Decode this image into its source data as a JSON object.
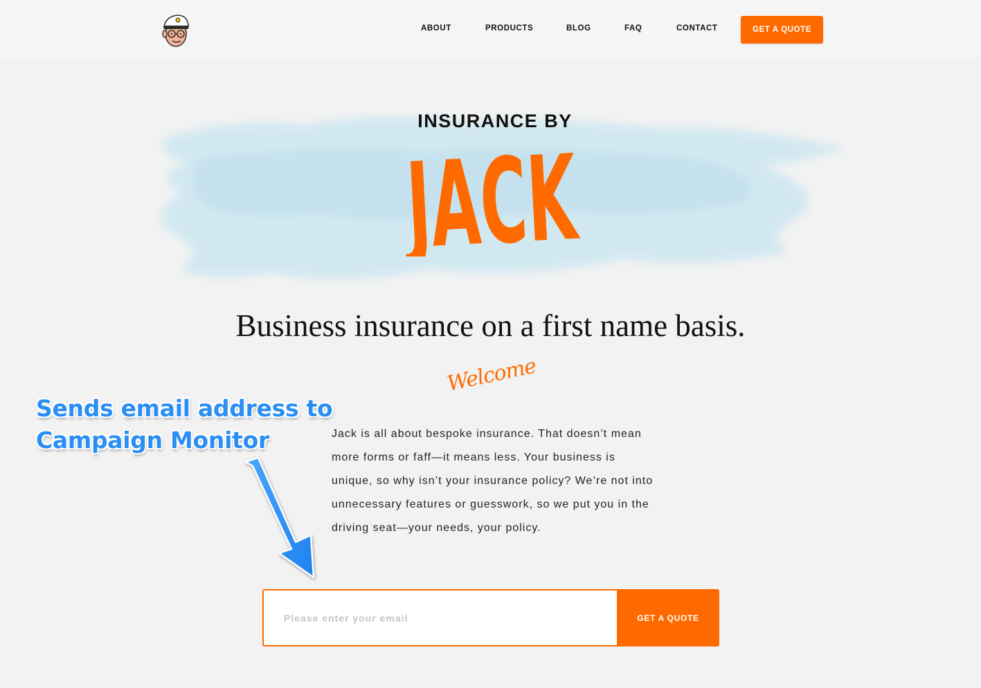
{
  "nav": {
    "logo": "sailor-mascot-logo",
    "links": [
      "ABOUT",
      "PRODUCTS",
      "BLOG",
      "FAQ",
      "CONTACT"
    ],
    "quote_button": "GET A QUOTE"
  },
  "hero": {
    "brand_top": "INSURANCE BY",
    "brand_name": "JACK",
    "headline": "Business insurance on a first name basis.",
    "welcome": "Welcome",
    "intro": "Jack is all about bespoke insurance. That doesn’t mean more forms or faff—it means less. Your business is unique, so why isn’t your insurance policy? We’re not into unnecessary features or guesswork, so we put you in the driving seat—your needs, your policy."
  },
  "signup": {
    "email_placeholder": "Please enter your email",
    "submit_label": "GET A QUOTE"
  },
  "annotation": {
    "line1": "Sends email address to",
    "line2": "Campaign Monitor"
  },
  "colors": {
    "accent": "#ff6a00",
    "annotation": "#2a8ef3",
    "wash": "#bfe0ec"
  }
}
